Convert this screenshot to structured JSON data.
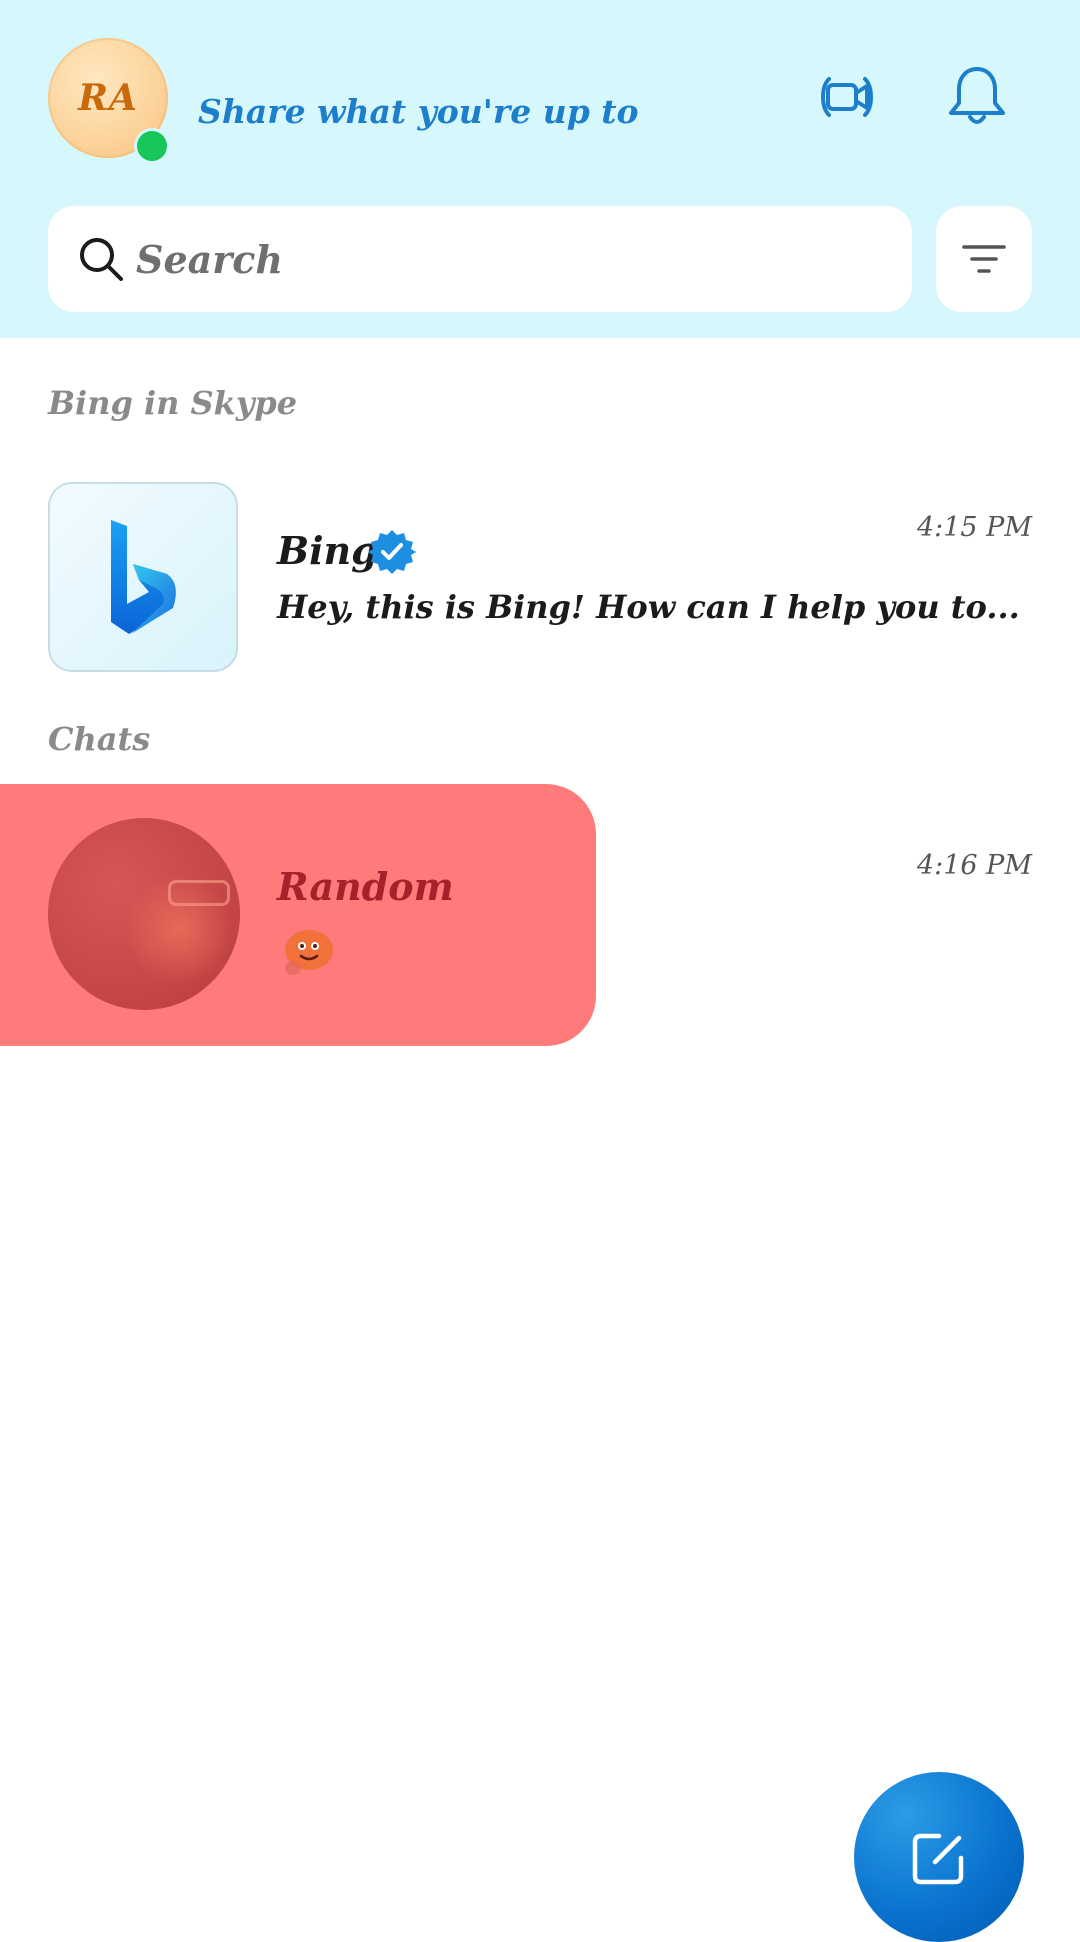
{
  "header": {
    "avatar_initials": "RA",
    "status_placeholder": "Share what you're up to",
    "video_icon": "video-call-icon",
    "bell_icon": "bell-icon"
  },
  "search": {
    "placeholder": "Search",
    "filter_icon": "filter-icon"
  },
  "sections": {
    "bing_label": "Bing in Skype",
    "chats_label": "Chats"
  },
  "bing_chat": {
    "name": "Bing",
    "preview": "Hey, this is Bing! How can I help you to...",
    "time": "4:15 PM",
    "verified": true
  },
  "random_chat": {
    "name": "Random",
    "preview_icon": "emoji-sticker-icon",
    "time": "4:16 PM"
  },
  "fab": {
    "icon": "new-chat-icon"
  },
  "colors": {
    "header_bg": "#d6f7fb",
    "accent": "#1d7fcb",
    "presence": "#18c75a",
    "highlight": "#ff7a7a"
  }
}
